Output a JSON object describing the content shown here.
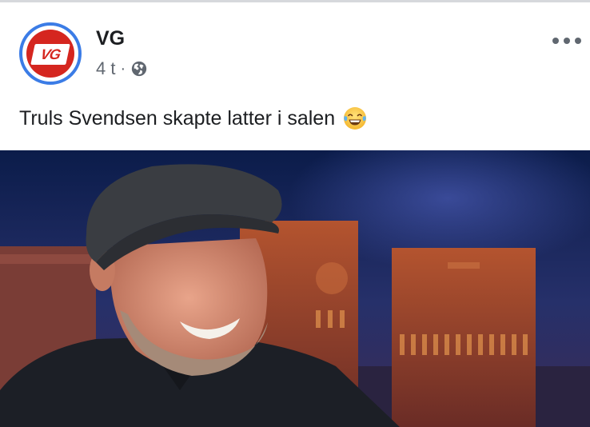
{
  "post": {
    "page_name": "VG",
    "avatar_logo_text": "VG",
    "timestamp": "4 t",
    "separator": "·",
    "privacy_icon": "globe-icon",
    "more_icon": "more-options-icon",
    "text": "Truls Svendsen skapte latter i salen",
    "emoji_icon": "face-with-tears-of-joy-icon"
  },
  "colors": {
    "avatar_ring": "#3b7ce6",
    "avatar_bg": "#d5261f",
    "text_primary": "#1c1e21",
    "text_secondary": "#606770"
  }
}
